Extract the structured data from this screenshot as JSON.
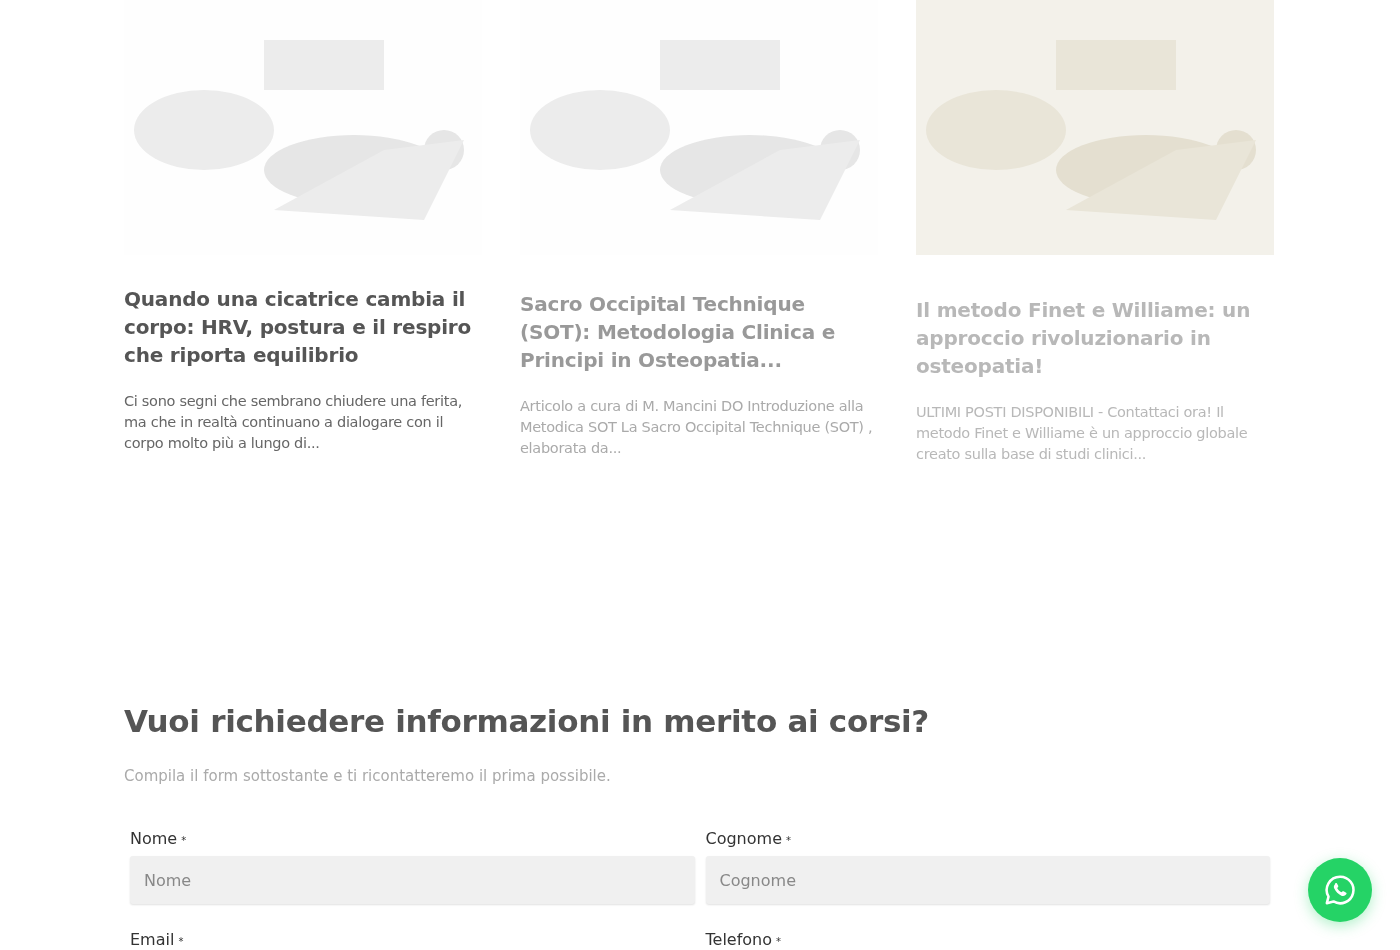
{
  "posts": [
    {
      "title": "Quando una cicatrice cambia il corpo: HRV, postura e il respiro che riporta equilibrio",
      "excerpt": "Ci sono segni che sembrano chiudere una ferita, ma che in realtà continuano a dialogare con il corpo molto più a lungo di..."
    },
    {
      "title": "Sacro Occipital Technique (SOT): Metodologia Clinica e Principi in Osteopatia...",
      "excerpt": "Articolo a cura di M. Mancini DO Introduzione alla Metodica SOT La  Sacro Occipital Technique (SOT) , elaborata da..."
    },
    {
      "title": "Il metodo Finet e Williame: un approccio rivoluzionario in osteopatia!",
      "excerpt": "ULTIMI POSTI DISPONIBILI - Contattaci ora! Il metodo Finet e Williame è un approccio globale creato sulla base di studi clinici..."
    }
  ],
  "form": {
    "heading": "Vuoi richiedere informazioni in merito ai corsi?",
    "intro": "Compila il form sottostante e ti ricontatteremo il prima possibile.",
    "fields": [
      {
        "label": "Nome",
        "required_mark": "*",
        "placeholder": "Nome"
      },
      {
        "label": "Cognome",
        "required_mark": "*",
        "placeholder": "Cognome"
      },
      {
        "label": "Email",
        "required_mark": "*"
      },
      {
        "label": "Telefono",
        "required_mark": "*"
      }
    ]
  }
}
